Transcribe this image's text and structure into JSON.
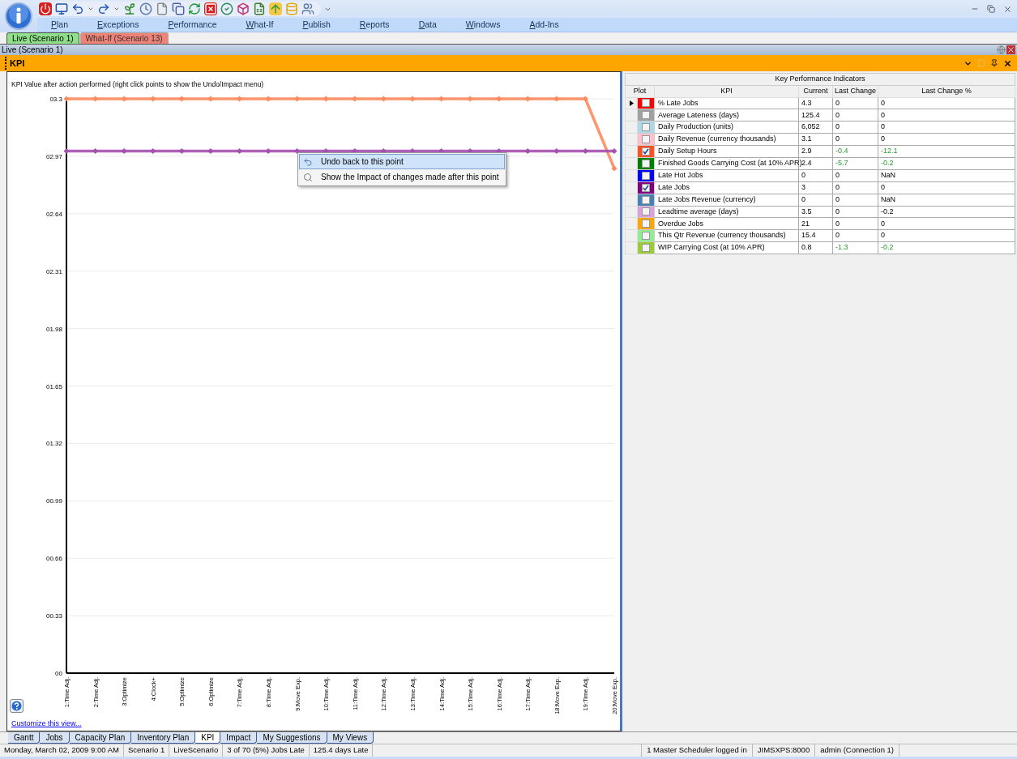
{
  "menu": [
    "Plan",
    "Exceptions",
    "Performance",
    "What-If",
    "Publish",
    "Reports",
    "Data",
    "Windows",
    "Add-Ins"
  ],
  "scenario_tabs": [
    {
      "label": "Live (Scenario 1)",
      "selected": true,
      "color": "#90e08a"
    },
    {
      "label": "What-If (Scenario 13)",
      "selected": false,
      "color": "#f08378"
    }
  ],
  "document_bar": {
    "title": "Live (Scenario 1)"
  },
  "panel": {
    "title": "KPI"
  },
  "chart": {
    "caption": "KPI Value after action performed (right click points to show the Undo/Impact menu)",
    "chart_data": {
      "type": "line",
      "categories": [
        "1:Time Adj.",
        "2:Time Adj.",
        "3:Optimize",
        "4:Clock+",
        "5:Optimize",
        "6:Optimize",
        "7:Time Adj.",
        "8:Time Adj.",
        "9:Move Exp.",
        "10:Time Adj.",
        "11:Time Adj.",
        "12:Time Adj.",
        "13:Time Adj.",
        "14:Time Adj.",
        "15:Time Adj.",
        "16:Time Adj.",
        "17:Time Adj.",
        "18:Move Exp.",
        "19:Time Adj.",
        "20:Move Exp."
      ],
      "grid": true,
      "series": [
        {
          "marker": "diamond",
          "color": "#ff8a5c",
          "values": [
            3.3,
            3.3,
            3.3,
            3.3,
            3.3,
            3.3,
            3.3,
            3.3,
            3.3,
            3.3,
            3.3,
            3.3,
            3.3,
            3.3,
            3.3,
            3.3,
            3.3,
            3.3,
            3.3,
            2.9
          ]
        },
        {
          "marker": "diamond",
          "color": "#a650b0",
          "values": [
            3,
            3,
            3,
            3,
            3,
            3,
            3,
            3,
            3,
            3,
            3,
            3,
            3,
            3,
            3,
            3,
            3,
            3,
            3,
            3
          ]
        }
      ],
      "ylim": [
        0,
        3.3
      ],
      "yticks": [
        {
          "value": 3.3,
          "label": "03.3"
        },
        {
          "value": 2.97,
          "label": "02.97"
        },
        {
          "value": 2.64,
          "label": "02.64"
        },
        {
          "value": 2.31,
          "label": "02.31"
        },
        {
          "value": 1.98,
          "label": "01.98"
        },
        {
          "value": 1.65,
          "label": "01.65"
        },
        {
          "value": 1.32,
          "label": "01.32"
        },
        {
          "value": 0.99,
          "label": "00.99"
        },
        {
          "value": 0.66,
          "label": "00.66"
        },
        {
          "value": 0.33,
          "label": "00.33"
        },
        {
          "value": 0,
          "label": "00"
        }
      ]
    },
    "context_menu": [
      {
        "label": "Undo back to this point",
        "selected": true
      },
      {
        "label": "Show the Impact of changes made after this point",
        "selected": false
      }
    ],
    "customize_link": "Customize this view..."
  },
  "kpi_table": {
    "title": "Key Performance Indicators",
    "columns": [
      "Plot",
      "KPI",
      "Current",
      "Last Change",
      "Last Change %"
    ],
    "rows": [
      {
        "selected": true,
        "color": "#ff0000",
        "checked": false,
        "kpi": "% Late Jobs",
        "current": "4.3",
        "last_change": "0",
        "last_change_pct": "0",
        "improved": false
      },
      {
        "selected": false,
        "color": "#a0a0a0",
        "checked": false,
        "kpi": "Average Lateness (days)",
        "current": "125.4",
        "last_change": "0",
        "last_change_pct": "0",
        "improved": false
      },
      {
        "selected": false,
        "color": "#add8e6",
        "checked": false,
        "kpi": "Daily Production (units)",
        "current": "6,052",
        "last_change": "0",
        "last_change_pct": "0",
        "improved": false
      },
      {
        "selected": false,
        "color": "#ffc0cb",
        "checked": false,
        "kpi": "Daily Revenue (currency thousands)",
        "current": "3.1",
        "last_change": "0",
        "last_change_pct": "0",
        "improved": false
      },
      {
        "selected": false,
        "color": "#ff5020",
        "checked": true,
        "kpi": "Daily Setup Hours",
        "current": "2.9",
        "last_change": "-0.4",
        "last_change_pct": "-12.1",
        "improved": true
      },
      {
        "selected": false,
        "color": "#008000",
        "checked": false,
        "kpi": "Finished Goods Carrying Cost (at 10% APR)",
        "current": "2.4",
        "last_change": "-5.7",
        "last_change_pct": "-0.2",
        "improved": true
      },
      {
        "selected": false,
        "color": "#0000ff",
        "checked": false,
        "kpi": "Late Hot Jobs",
        "current": "0",
        "last_change": "0",
        "last_change_pct": "NaN",
        "improved": false
      },
      {
        "selected": false,
        "color": "#800080",
        "checked": true,
        "kpi": "Late Jobs",
        "current": "3",
        "last_change": "0",
        "last_change_pct": "0",
        "improved": false
      },
      {
        "selected": false,
        "color": "#4682b4",
        "checked": false,
        "kpi": "Late Jobs Revenue (currency)",
        "current": "0",
        "last_change": "0",
        "last_change_pct": "NaN",
        "improved": false
      },
      {
        "selected": false,
        "color": "#dda0dd",
        "checked": false,
        "kpi": "Leadtime average (days)",
        "current": "3.5",
        "last_change": "0",
        "last_change_pct": "-0.2",
        "improved": false
      },
      {
        "selected": false,
        "color": "#ffa500",
        "checked": false,
        "kpi": "Overdue Jobs",
        "current": "21",
        "last_change": "0",
        "last_change_pct": "0",
        "improved": false
      },
      {
        "selected": false,
        "color": "#90ee90",
        "checked": false,
        "kpi": "This Qtr Revenue (currency thousands)",
        "current": "15.4",
        "last_change": "0",
        "last_change_pct": "0",
        "improved": false
      },
      {
        "selected": false,
        "color": "#9acd32",
        "checked": false,
        "kpi": "WIP Carrying Cost (at 10% APR)",
        "current": "0.8",
        "last_change": "-1.3",
        "last_change_pct": "-0.2",
        "improved": true
      }
    ]
  },
  "view_tabs": [
    {
      "label": "Gantt",
      "selected": false
    },
    {
      "label": "Jobs",
      "selected": false
    },
    {
      "label": "Capacity Plan",
      "selected": false
    },
    {
      "label": "Inventory Plan",
      "selected": false
    },
    {
      "label": "KPI",
      "selected": true
    },
    {
      "label": "Impact",
      "selected": false
    },
    {
      "label": "My Suggestions",
      "selected": false
    },
    {
      "label": "My Views",
      "selected": false
    }
  ],
  "status_bar": {
    "left": [
      "Monday, March 02, 2009 9:00 AM",
      "Scenario 1",
      "LiveScenario",
      "3 of 70 (5%) Jobs Late",
      "125.4 days Late"
    ],
    "right": [
      "1 Master Scheduler logged in",
      "JIMSXPS:8000",
      "admin (Connection 1)"
    ]
  }
}
